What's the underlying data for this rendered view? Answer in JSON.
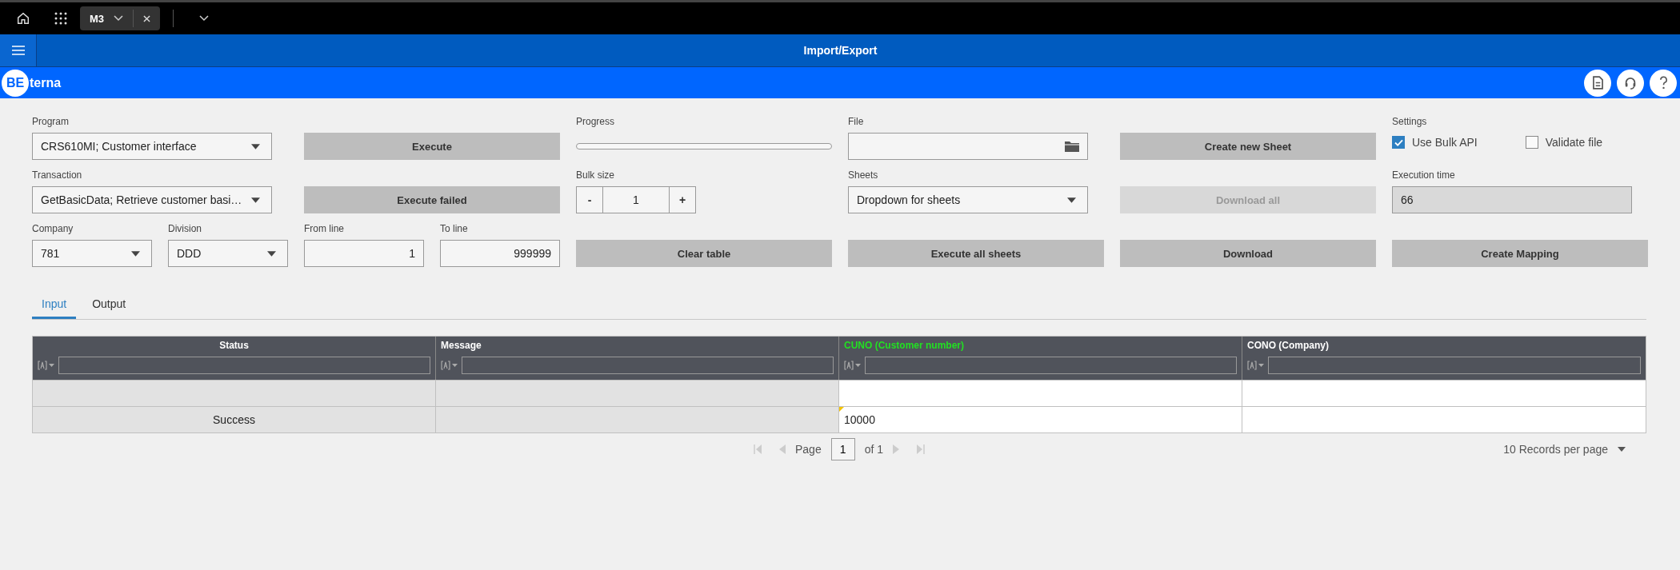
{
  "top_bar": {
    "tab": {
      "label": "M3",
      "selected": true
    }
  },
  "title_bar": {
    "title": "Import/Export"
  },
  "brand": {
    "logo_mark": "BE",
    "logo_text": "terna"
  },
  "form": {
    "rows": [
      [
        {
          "kind": "dropdown",
          "label": "Program",
          "value": "CRS610MI; Customer interface"
        },
        {
          "kind": "button",
          "text": "Execute",
          "disabled": false
        },
        {
          "kind": "progress",
          "label": "Progress",
          "level": 0
        },
        {
          "kind": "file",
          "label": "File"
        },
        {
          "kind": "button",
          "text": "Create new Sheet",
          "disabled": false
        },
        {
          "kind": "settings",
          "label": "Settings",
          "options": [
            {
              "label": "Use Bulk API",
              "checked": true
            },
            {
              "label": "Validate file",
              "checked": false
            }
          ]
        }
      ],
      [
        {
          "kind": "dropdown",
          "label": "Transaction",
          "value": "GetBasicData; Retrieve customer basi…"
        },
        {
          "kind": "button",
          "text": "Execute failed",
          "disabled": false
        },
        {
          "kind": "stepper",
          "label": "Bulk size",
          "minus": "-",
          "value": "1",
          "plus": "+"
        },
        {
          "kind": "dropdown",
          "label": "Sheets",
          "value": "Dropdown for sheets"
        },
        {
          "kind": "button",
          "text": "Download all",
          "disabled": true
        },
        {
          "kind": "input",
          "label": "Execution time",
          "value": "66",
          "readonly": true
        }
      ],
      [
        {
          "kind": "pair",
          "items": [
            {
              "kind": "dropdown",
              "label": "Company",
              "value": "781"
            },
            {
              "kind": "dropdown",
              "label": "Division",
              "value": "DDD"
            }
          ]
        },
        {
          "kind": "pair",
          "items": [
            {
              "kind": "number",
              "label": "From line",
              "value": "1",
              "readonly": false
            },
            {
              "kind": "number",
              "label": "To line",
              "value": "999999",
              "readonly": false
            }
          ]
        },
        {
          "kind": "button",
          "text": "Clear table",
          "disabled": false
        },
        {
          "kind": "button",
          "text": "Execute all sheets",
          "disabled": false
        },
        {
          "kind": "button",
          "text": "Download",
          "disabled": false
        },
        {
          "kind": "button",
          "text": "Create Mapping",
          "disabled": false
        }
      ]
    ]
  },
  "tabs": [
    {
      "label": "Input",
      "selected": true
    },
    {
      "label": "Output",
      "selected": false
    }
  ],
  "table": {
    "columns": [
      {
        "label": "Status",
        "highlighted": false,
        "editable": false
      },
      {
        "label": "Message",
        "highlighted": false,
        "editable": false
      },
      {
        "label": "CUNO (Customer number)",
        "highlighted": true,
        "editable": true
      },
      {
        "label": "CONO (Company)",
        "highlighted": false,
        "editable": true
      }
    ],
    "rows": [
      [
        {},
        {},
        {},
        {}
      ],
      [
        {
          "text": "Success"
        },
        {},
        {
          "text": "10000",
          "flagged": true
        },
        {}
      ]
    ]
  },
  "pagination": {
    "page_label": "Page",
    "page": "1",
    "of_label": "of 1",
    "per_page": "10 Records per page"
  }
}
